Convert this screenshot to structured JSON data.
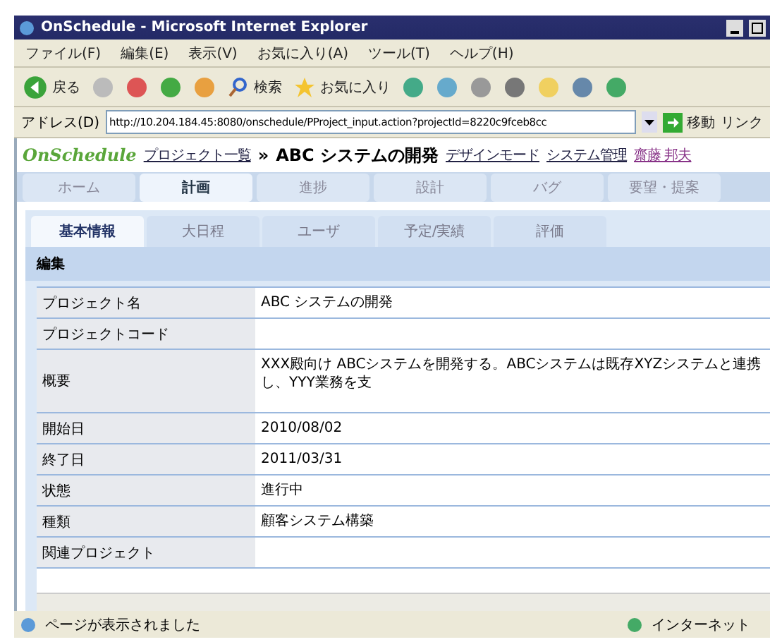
{
  "window": {
    "title": "OnSchedule - Microsoft Internet Explorer"
  },
  "menu": [
    "ファイル(F)",
    "編集(E)",
    "表示(V)",
    "お気に入り(A)",
    "ツール(T)",
    "ヘルプ(H)"
  ],
  "toolbar": {
    "back": "戻る",
    "search": "検索",
    "favorites": "お気に入り"
  },
  "address": {
    "label": "アドレス(D)",
    "value": "http://10.204.184.45:8080/onschedule/PProject_input.action?projectId=8220c9fceb8cc",
    "go": "移動",
    "links": "リンク"
  },
  "app_header": {
    "logo": "OnSchedule",
    "project_list": "プロジェクト一覧",
    "separator": "»",
    "project": "ABC システムの開発",
    "design_mode": "デザインモード",
    "admin": "システム管理",
    "user": "齋藤 邦夫"
  },
  "nav_tabs": [
    {
      "label": "ホーム",
      "selected": false
    },
    {
      "label": "計画",
      "selected": true
    },
    {
      "label": "進捗",
      "selected": false
    },
    {
      "label": "設計",
      "selected": false
    },
    {
      "label": "バグ",
      "selected": false
    },
    {
      "label": "要望・提案",
      "selected": false
    }
  ],
  "sub_tabs": [
    {
      "label": "基本情報",
      "selected": true
    },
    {
      "label": "大日程",
      "selected": false
    },
    {
      "label": "ユーザ",
      "selected": false
    },
    {
      "label": "予定/実績",
      "selected": false
    },
    {
      "label": "評価",
      "selected": false
    }
  ],
  "section": "編集",
  "fields": [
    {
      "label": "プロジェクト名",
      "value": "ABC システムの開発"
    },
    {
      "label": "プロジェクトコード"
    },
    {
      "label": "概要",
      "value": "XXX殿向け ABCシステムを開発する。ABCシステムは既存XYZシステムと連携し、YYY業務を支",
      "tall": true
    },
    {
      "label": "開始日",
      "value": "2010/08/02"
    },
    {
      "label": "終了日",
      "value": "2011/03/31"
    },
    {
      "label": "状態",
      "value": "進行中"
    },
    {
      "label": "種類",
      "value": "顧客システム構築"
    },
    {
      "label": "関連プロジェクト"
    }
  ],
  "status_bar": {
    "message": "ページが表示されました",
    "zone": "インターネット"
  }
}
